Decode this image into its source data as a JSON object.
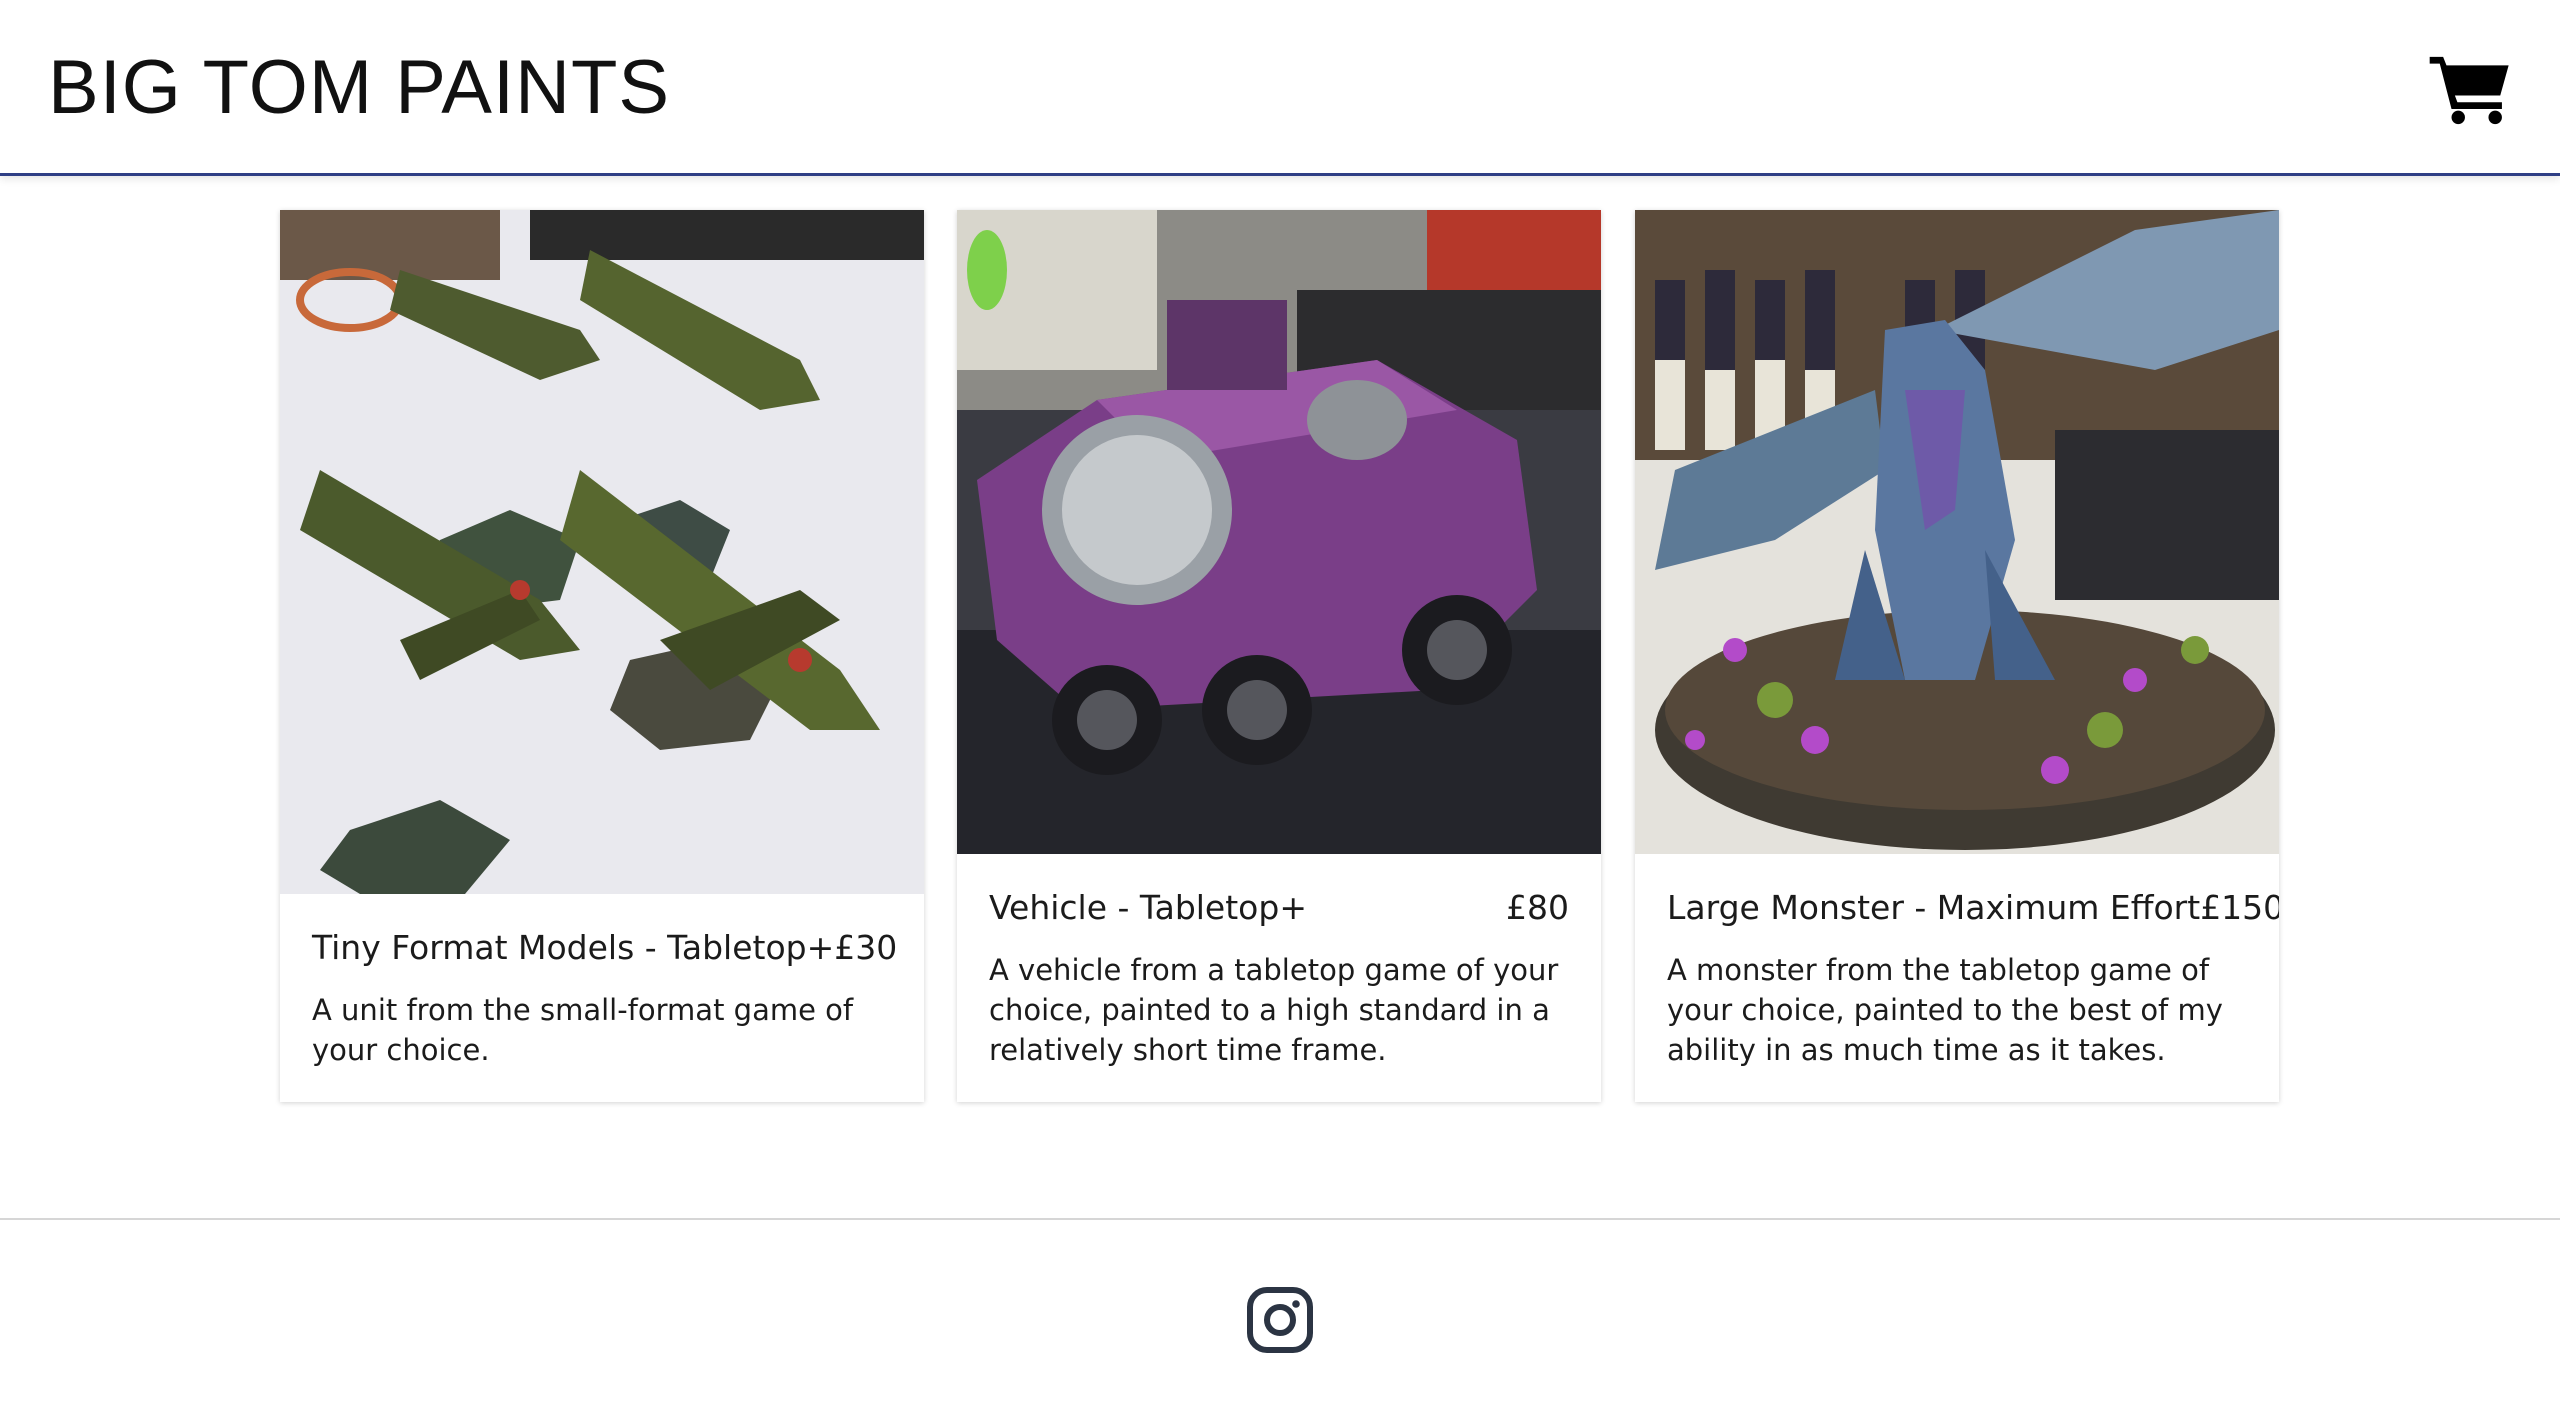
{
  "header": {
    "brand": "BIG TOM PAINTS",
    "cart_icon": "shopping-cart-icon"
  },
  "products": [
    {
      "title": "Tiny Format Models - Tabletop+",
      "price": "£30",
      "description": "A unit from the small-format game of your choice.",
      "image": "painted-fighter-jet-miniatures-photo"
    },
    {
      "title": "Vehicle - Tabletop+",
      "price": "£80",
      "description": "A vehicle from a tabletop game of your choice, painted to a high standard in a relatively short time frame.",
      "image": "painted-purple-armoured-vehicle-photo"
    },
    {
      "title": "Large Monster - Maximum Effort",
      "price": "£150",
      "description": "A monster from the tabletop game of your choice, painted to the best of my ability in as much time as it takes.",
      "image": "painted-blue-dragon-miniature-photo"
    }
  ],
  "footer": {
    "social_icon": "instagram-icon"
  },
  "colors": {
    "header_border": "#2f3f85",
    "text": "#1b1b1b",
    "icon": "#2b3443"
  }
}
